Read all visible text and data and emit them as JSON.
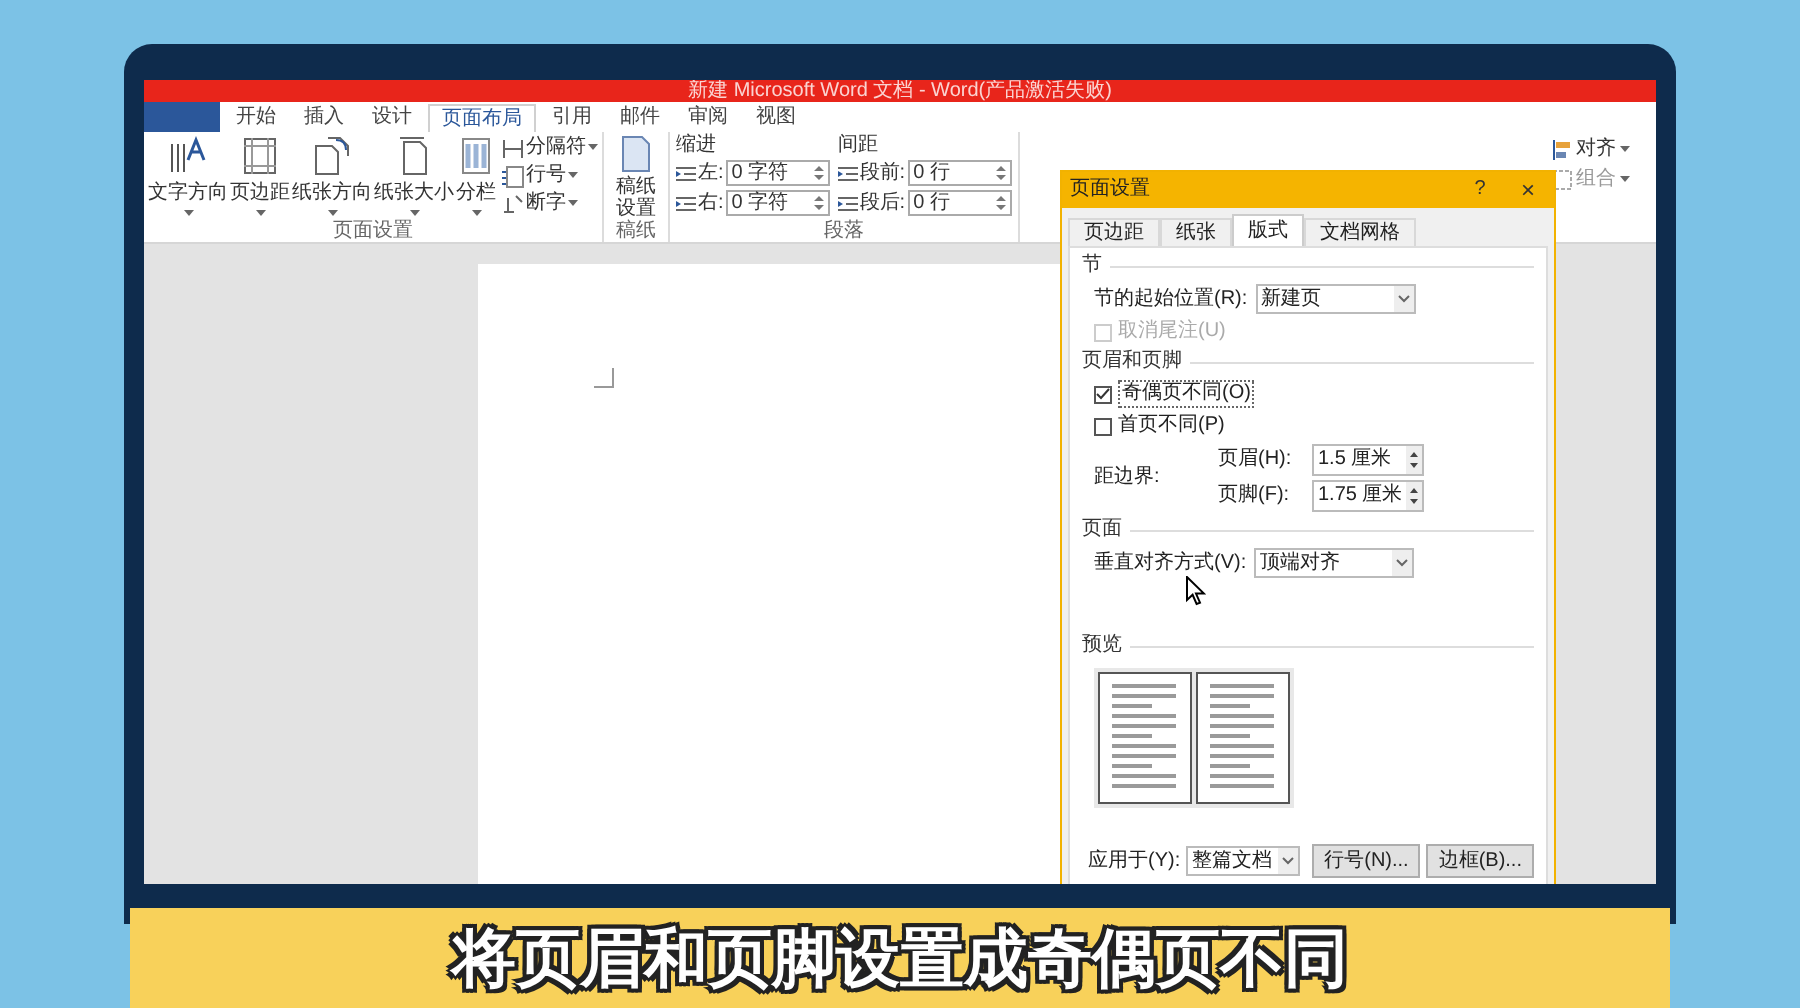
{
  "window": {
    "title": "新建 Microsoft Word 文档 - Word(产品激活失败)"
  },
  "ribbon_tabs": [
    {
      "label": "开始",
      "selected": false
    },
    {
      "label": "插入",
      "selected": false
    },
    {
      "label": "设计",
      "selected": false
    },
    {
      "label": "页面布局",
      "selected": true
    },
    {
      "label": "引用",
      "selected": false
    },
    {
      "label": "邮件",
      "selected": false
    },
    {
      "label": "审阅",
      "selected": false
    },
    {
      "label": "视图",
      "selected": false
    }
  ],
  "page_setup_group": {
    "label": "页面设置",
    "large_buttons": [
      "文字方向",
      "页边距",
      "纸张方向",
      "纸张大小",
      "分栏"
    ],
    "small_buttons": [
      "分隔符",
      "行号",
      "断字"
    ]
  },
  "draft_group": {
    "label": "稿纸",
    "button": "稿纸设置"
  },
  "paragraph_group": {
    "label": "段落",
    "indent": {
      "heading": "缩进",
      "rows": [
        {
          "label": "左:",
          "value": "0 字符"
        },
        {
          "label": "右:",
          "value": "0 字符"
        }
      ]
    },
    "spacing": {
      "heading": "间距",
      "rows": [
        {
          "label": "段前:",
          "value": "0 行"
        },
        {
          "label": "段后:",
          "value": "0 行"
        }
      ]
    }
  },
  "arrange_group": {
    "buttons": [
      "对齐",
      "组合"
    ]
  },
  "dialog": {
    "title": "页面设置",
    "help": "?",
    "close": "×",
    "tabs": [
      {
        "label": "页边距",
        "selected": false
      },
      {
        "label": "纸张",
        "selected": false
      },
      {
        "label": "版式",
        "selected": true
      },
      {
        "label": "文档网格",
        "selected": false
      }
    ],
    "section": {
      "heading": "节",
      "start_label": "节的起始位置(R):",
      "start_value": "新建页",
      "suppress_endnotes": {
        "label": "取消尾注(U)",
        "checked": false,
        "disabled": true
      }
    },
    "headers_footers": {
      "heading": "页眉和页脚",
      "checkboxes": [
        {
          "label": "奇偶页不同(O)",
          "checked": true,
          "disabled": false
        },
        {
          "label": "首页不同(P)",
          "checked": false,
          "disabled": false
        }
      ],
      "from_edge_label": "距边界:",
      "spinners": [
        {
          "label": "页眉(H):",
          "value": "1.5 厘米"
        },
        {
          "label": "页脚(F):",
          "value": "1.75 厘米"
        }
      ]
    },
    "page": {
      "heading": "页面",
      "align_label": "垂直对齐方式(V):",
      "align_value": "顶端对齐"
    },
    "preview": {
      "heading": "预览"
    },
    "apply_label": "应用于(Y):",
    "apply_value": "整篇文档",
    "buttons": [
      "行号(N)...",
      "边框(B)..."
    ]
  },
  "caption": "将页眉和页脚设置成奇偶页不同"
}
